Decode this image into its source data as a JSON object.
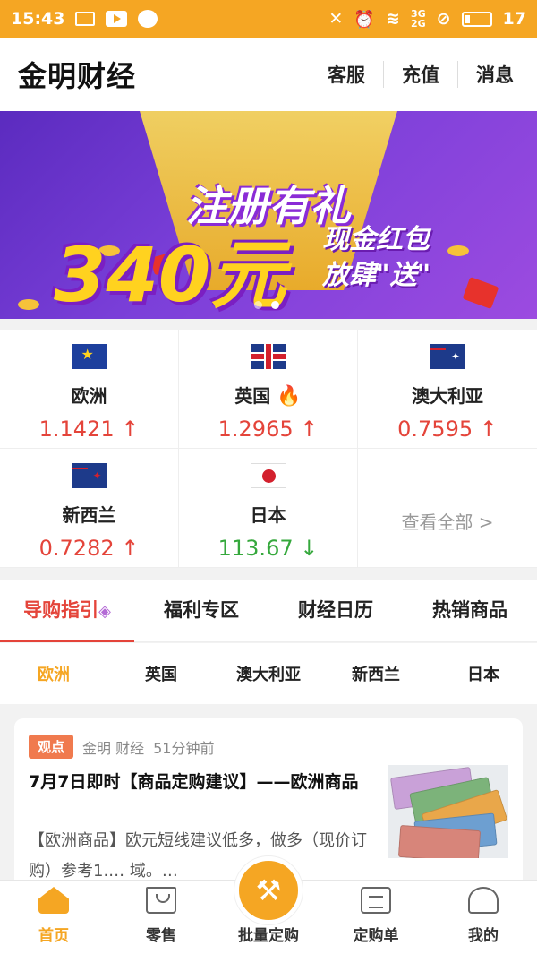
{
  "status_bar": {
    "time": "15:43",
    "network1": "3G",
    "network2": "2G",
    "battery": "17"
  },
  "header": {
    "brand": "金明财经",
    "links": [
      "客服",
      "充值",
      "消息"
    ]
  },
  "banner": {
    "line1": "注册有礼",
    "amount": "340元",
    "line2": "现金红包",
    "line3": "放肆\"送\""
  },
  "currencies": [
    {
      "name": "欧洲",
      "flag": "eu-flag-icon",
      "rate": "1.1421",
      "direction": "up"
    },
    {
      "name": "英国",
      "flag": "uk-flag-icon",
      "rate": "1.2965",
      "direction": "up",
      "hot": true
    },
    {
      "name": "澳大利亚",
      "flag": "au-flag-icon",
      "rate": "0.7595",
      "direction": "up"
    },
    {
      "name": "新西兰",
      "flag": "nz-flag-icon",
      "rate": "0.7282",
      "direction": "up"
    },
    {
      "name": "日本",
      "flag": "jp-flag-icon",
      "rate": "113.67",
      "direction": "down"
    }
  ],
  "view_all": "查看全部 >",
  "tabs": [
    "导购指引",
    "福利专区",
    "财经日历",
    "热销商品"
  ],
  "subtabs": [
    "欧洲",
    "英国",
    "澳大利亚",
    "新西兰",
    "日本"
  ],
  "article": {
    "tag": "观点",
    "source": "金明 财经",
    "time": "51分钟前",
    "title": "7月7日即时【商品定购建议】——欧洲商品",
    "excerpt": "【欧洲商品】欧元短线建议低多，做多（现价订购）参考1.… 域。…"
  },
  "bottom_nav": [
    "首页",
    "零售",
    "批量定购",
    "定购单",
    "我的"
  ],
  "colors": {
    "accent": "#f5a623",
    "up": "#e4443a",
    "down": "#35a83c"
  }
}
